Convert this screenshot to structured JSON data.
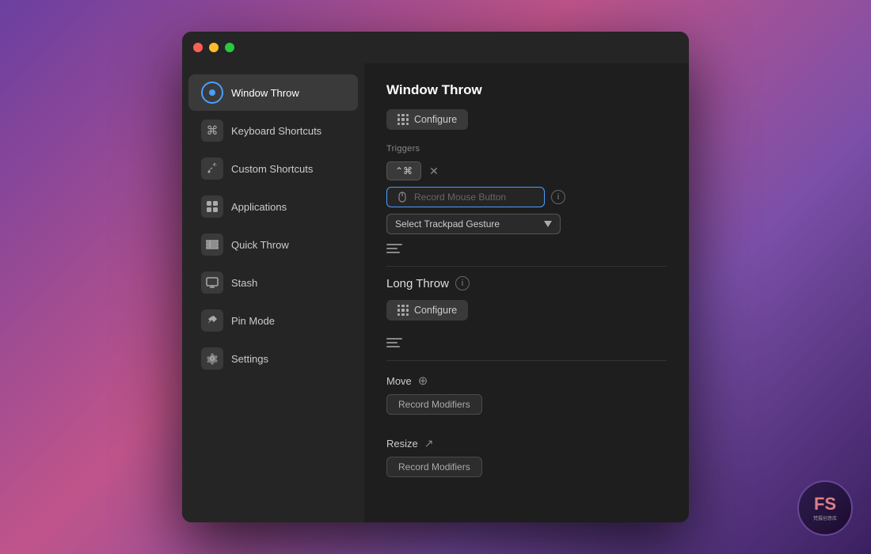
{
  "titlebar": {
    "buttons": [
      "close",
      "minimize",
      "maximize"
    ]
  },
  "sidebar": {
    "items": [
      {
        "id": "window-throw",
        "label": "Window Throw",
        "icon": "circle-icon",
        "active": true
      },
      {
        "id": "keyboard-shortcuts",
        "label": "Keyboard Shortcuts",
        "icon": "command-icon",
        "active": false
      },
      {
        "id": "custom-shortcuts",
        "label": "Custom Shortcuts",
        "icon": "wrench-icon",
        "active": false
      },
      {
        "id": "applications",
        "label": "Applications",
        "icon": "app-store-icon",
        "active": false
      },
      {
        "id": "quick-throw",
        "label": "Quick Throw",
        "icon": "grid-lines-icon",
        "active": false
      },
      {
        "id": "stash",
        "label": "Stash",
        "icon": "monitor-icon",
        "active": false
      },
      {
        "id": "pin-mode",
        "label": "Pin Mode",
        "icon": "pin-icon",
        "active": false
      },
      {
        "id": "settings",
        "label": "Settings",
        "icon": "gear-icon",
        "active": false
      }
    ]
  },
  "main": {
    "section_title": "Window Throw",
    "configure_btn_label": "Configure",
    "triggers_label": "Triggers",
    "shortcut_value": "⌃⌘",
    "record_mouse_placeholder": "Record Mouse Button",
    "trackpad_select_label": "Select Trackpad Gesture",
    "long_throw_title": "Long Throw",
    "long_throw_configure_label": "Configure",
    "move_label": "Move",
    "record_modifiers_move_label": "Record Modifiers",
    "resize_label": "Resize",
    "record_modifiers_resize_label": "Record Modifiers"
  }
}
